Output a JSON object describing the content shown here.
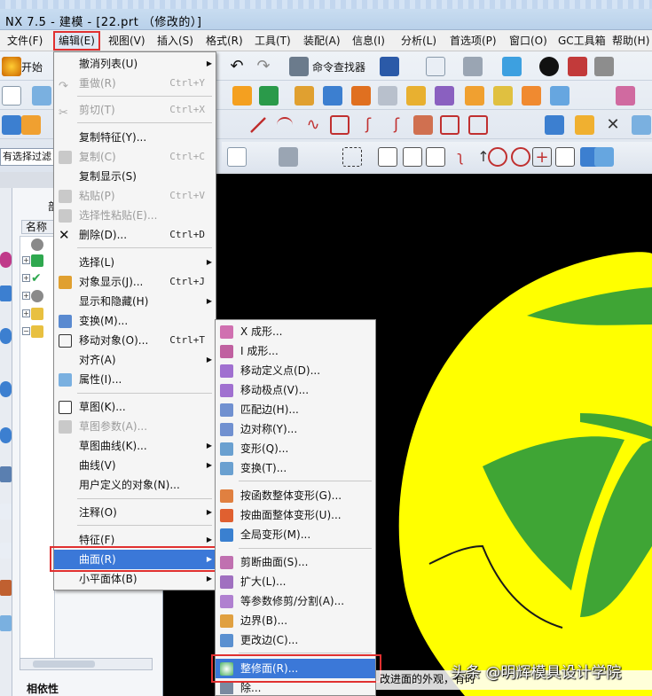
{
  "window": {
    "title": "NX 7.5 - 建模 - [22.prt （修改的）]"
  },
  "menubar": {
    "items": [
      {
        "label": "文件(F)"
      },
      {
        "label": "编辑(E)"
      },
      {
        "label": "视图(V)"
      },
      {
        "label": "插入(S)"
      },
      {
        "label": "格式(R)"
      },
      {
        "label": "工具(T)"
      },
      {
        "label": "装配(A)"
      },
      {
        "label": "信息(I)"
      },
      {
        "label": "分析(L)"
      },
      {
        "label": "首选项(P)"
      },
      {
        "label": "窗口(O)"
      },
      {
        "label": "GC工具箱"
      },
      {
        "label": "帮助(H)"
      }
    ]
  },
  "toolbar": {
    "start_label": "开始",
    "command_finder_label": "命令查找器",
    "filter_text": "有选择过滤"
  },
  "navigator": {
    "header": "部",
    "column_name": "名称",
    "dependency_label": "相依性"
  },
  "edit_menu": {
    "items": [
      {
        "label": "撤消列表(U)",
        "shortcut": "",
        "submenu": true,
        "disabled": false
      },
      {
        "label": "重做(R)",
        "shortcut": "Ctrl+Y",
        "submenu": false,
        "disabled": true
      },
      {
        "label": "剪切(T)",
        "shortcut": "Ctrl+X",
        "submenu": false,
        "disabled": true
      },
      {
        "label": "复制特征(Y)...",
        "shortcut": "",
        "submenu": false,
        "disabled": false
      },
      {
        "label": "复制(C)",
        "shortcut": "Ctrl+C",
        "submenu": false,
        "disabled": true
      },
      {
        "label": "复制显示(S)",
        "shortcut": "",
        "submenu": false,
        "disabled": false
      },
      {
        "label": "粘贴(P)",
        "shortcut": "Ctrl+V",
        "submenu": false,
        "disabled": true
      },
      {
        "label": "选择性粘贴(E)...",
        "shortcut": "",
        "submenu": false,
        "disabled": true
      },
      {
        "label": "删除(D)...",
        "shortcut": "Ctrl+D",
        "submenu": false,
        "disabled": false
      },
      {
        "label": "选择(L)",
        "shortcut": "",
        "submenu": true,
        "disabled": false
      },
      {
        "label": "对象显示(J)...",
        "shortcut": "Ctrl+J",
        "submenu": false,
        "disabled": false
      },
      {
        "label": "显示和隐藏(H)",
        "shortcut": "",
        "submenu": true,
        "disabled": false
      },
      {
        "label": "变换(M)...",
        "shortcut": "",
        "submenu": false,
        "disabled": false
      },
      {
        "label": "移动对象(O)...",
        "shortcut": "Ctrl+T",
        "submenu": false,
        "disabled": false
      },
      {
        "label": "对齐(A)",
        "shortcut": "",
        "submenu": true,
        "disabled": false
      },
      {
        "label": "属性(I)...",
        "shortcut": "",
        "submenu": false,
        "disabled": false
      },
      {
        "label": "草图(K)...",
        "shortcut": "",
        "submenu": false,
        "disabled": false
      },
      {
        "label": "草图参数(A)...",
        "shortcut": "",
        "submenu": false,
        "disabled": true
      },
      {
        "label": "草图曲线(K)...",
        "shortcut": "",
        "submenu": true,
        "disabled": false
      },
      {
        "label": "曲线(V)",
        "shortcut": "",
        "submenu": true,
        "disabled": false
      },
      {
        "label": "用户定义的对象(N)...",
        "shortcut": "",
        "submenu": false,
        "disabled": false
      },
      {
        "label": "注释(O)",
        "shortcut": "",
        "submenu": true,
        "disabled": false
      },
      {
        "label": "特征(F)",
        "shortcut": "",
        "submenu": true,
        "disabled": false
      },
      {
        "label": "曲面(R)",
        "shortcut": "",
        "submenu": true,
        "disabled": false
      },
      {
        "label": "小平面体(B)",
        "shortcut": "",
        "submenu": true,
        "disabled": false
      }
    ]
  },
  "surface_menu": {
    "items": [
      {
        "label": "X 成形..."
      },
      {
        "label": "I 成形..."
      },
      {
        "label": "移动定义点(D)..."
      },
      {
        "label": "移动极点(V)..."
      },
      {
        "label": "匹配边(H)..."
      },
      {
        "label": "边对称(Y)..."
      },
      {
        "label": "变形(Q)..."
      },
      {
        "label": "变换(T)..."
      },
      {
        "label": "按函数整体变形(G)..."
      },
      {
        "label": "按曲面整体变形(U)..."
      },
      {
        "label": "全局变形(M)..."
      },
      {
        "label": "剪断曲面(S)..."
      },
      {
        "label": "扩大(L)..."
      },
      {
        "label": "等参数修剪/分割(A)..."
      },
      {
        "label": "边界(B)..."
      },
      {
        "label": "更改边(C)..."
      },
      {
        "label": "整修面(R)..."
      },
      {
        "label": "除..."
      }
    ]
  },
  "status": {
    "hint": "改进面的外观，有时"
  },
  "watermark": "头条 @明辉模具设计学院",
  "colors": {
    "highlight": "#e03030",
    "selection": "#3b78d8",
    "surface_yellow": "#ffff00",
    "surface_green": "#3fa535",
    "viewport_bg": "#000000"
  }
}
